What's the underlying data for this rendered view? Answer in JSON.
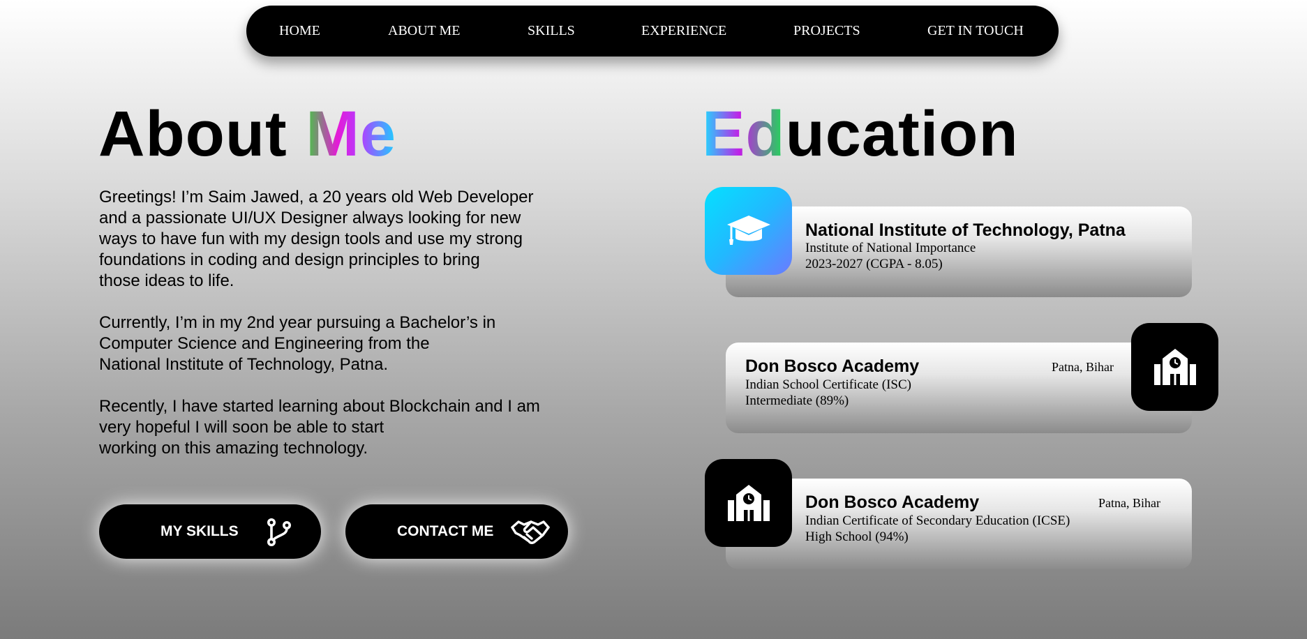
{
  "nav": {
    "items": [
      "HOME",
      "ABOUT ME",
      "SKILLS",
      "EXPERIENCE",
      "PROJECTS",
      "GET IN TOUCH"
    ]
  },
  "about": {
    "title_plain": "About ",
    "title_accent": "Me",
    "paragraphs": [
      [
        "Greetings! I’m Saim Jawed, a 20 years old Web Developer",
        "and a passionate UI/UX Designer always looking for new",
        "ways to have fun with my design tools and use my strong",
        "foundations in coding and design principles to bring",
        "those ideas to life."
      ],
      [
        "Currently, I’m in my 2nd year pursuing a Bachelor’s in",
        "Computer Science and Engineering from the",
        "National Institute of Technology, Patna."
      ],
      [
        "Recently, I have started learning about Blockchain and I am",
        "very hopeful I will soon be able to start",
        "working on this amazing technology."
      ]
    ],
    "buttons": {
      "skills": {
        "label": "MY SKILLS",
        "icon": "git-branch-icon"
      },
      "contact": {
        "label": "CONTACT ME",
        "icon": "handshake-icon"
      }
    }
  },
  "education": {
    "title_accent": "Ed",
    "title_plain": "ucation",
    "entries": [
      {
        "institution": "National Institute of Technology, Patna",
        "line1": "Institute of National Importance",
        "line2": "2023-2027 (CGPA - 8.05)",
        "location": "",
        "icon": "graduation-cap-icon"
      },
      {
        "institution": "Don Bosco Academy",
        "line1": "Indian School Certificate (ISC)",
        "line2": "Intermediate (89%)",
        "location": "Patna, Bihar",
        "icon": "school-icon"
      },
      {
        "institution": "Don Bosco Academy",
        "line1": "Indian Certificate of Secondary Education (ICSE)",
        "line2": "High School (94%)",
        "location": "Patna, Bihar",
        "icon": "school-icon"
      }
    ]
  },
  "colors": {
    "nav_bg": "#000000",
    "accent_cyan": "#1ad1ff",
    "accent_magenta": "#e51ad7",
    "accent_green": "#3ecf3e"
  }
}
